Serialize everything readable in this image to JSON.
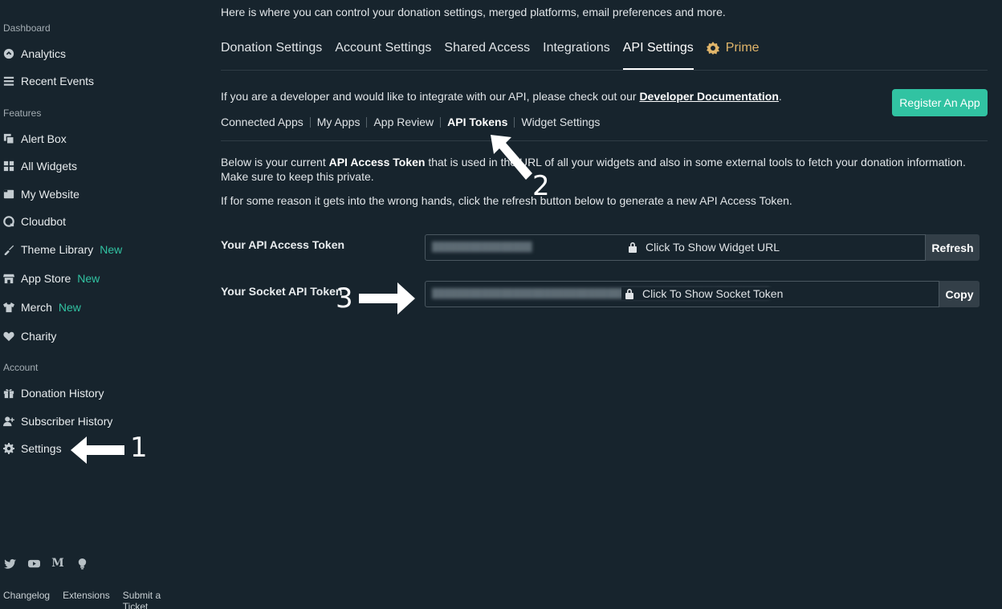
{
  "sidebar": {
    "sections": [
      {
        "label": "Dashboard"
      },
      {
        "label": "Features"
      },
      {
        "label": "Account"
      }
    ],
    "items": [
      {
        "label": "Analytics",
        "icon": "analytics-icon"
      },
      {
        "label": "Recent Events",
        "icon": "list-icon"
      },
      {
        "label": "Alert Box",
        "icon": "alert-box-icon"
      },
      {
        "label": "All Widgets",
        "icon": "grid-icon"
      },
      {
        "label": "My Website",
        "icon": "website-icon"
      },
      {
        "label": "Cloudbot",
        "icon": "cloudbot-icon"
      },
      {
        "label": "Theme Library",
        "icon": "theme-icon",
        "badge": "New"
      },
      {
        "label": "App Store",
        "icon": "store-icon",
        "badge": "New"
      },
      {
        "label": "Merch",
        "icon": "shirt-icon",
        "badge": "New"
      },
      {
        "label": "Charity",
        "icon": "heart-icon"
      },
      {
        "label": "Donation History",
        "icon": "gift-icon"
      },
      {
        "label": "Subscriber History",
        "icon": "add-user-icon"
      },
      {
        "label": "Settings",
        "icon": "gear-icon"
      }
    ],
    "social": [
      "twitter-icon",
      "youtube-icon",
      "medium-icon",
      "lightbulb-icon"
    ],
    "footer_links": [
      "Changelog",
      "Extensions",
      "Submit a Ticket"
    ]
  },
  "main": {
    "intro": "Here is where you can control your donation settings, merged platforms, email preferences and more.",
    "tabs": [
      {
        "label": "Donation Settings"
      },
      {
        "label": "Account Settings"
      },
      {
        "label": "Shared Access"
      },
      {
        "label": "Integrations"
      },
      {
        "label": "API Settings"
      },
      {
        "label": "Prime"
      }
    ],
    "dev_text": "If you are a developer and would like to integrate with our API, please check out our ",
    "dev_link": "Developer Documentation",
    "dev_text_end": ".",
    "register_button": "Register An App",
    "subtabs": [
      {
        "label": "Connected Apps"
      },
      {
        "label": "My Apps"
      },
      {
        "label": "App Review"
      },
      {
        "label": "API Tokens"
      },
      {
        "label": "Widget Settings"
      }
    ],
    "para1_pre": "Below is your current ",
    "para1_bold": "API Access Token",
    "para1_post": " that is used in the URL of all your widgets and also in some external tools to fetch your donation information. Make sure to keep this private.",
    "para2": "If for some reason it gets into the wrong hands, click the refresh button below to generate a new API Access Token.",
    "api_token": {
      "label": "Your API Access Token",
      "show_text": "Click To Show Widget URL",
      "button": "Refresh"
    },
    "socket_token": {
      "label": "Your Socket API Token",
      "show_text": "Click To Show Socket Token",
      "button": "Copy"
    }
  },
  "annotations": [
    "1",
    "2",
    "3"
  ],
  "colors": {
    "background": "#17242d",
    "accent": "#31c3a2",
    "prime": "#e0b56a"
  }
}
